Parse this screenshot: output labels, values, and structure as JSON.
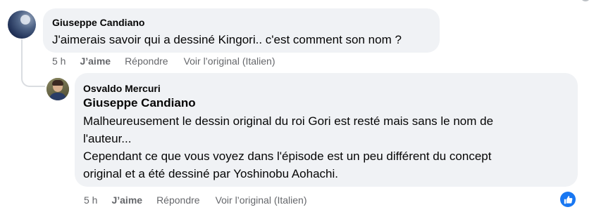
{
  "comments": [
    {
      "author": "Giuseppe Candiano",
      "text": "J'aimerais savoir qui a dessiné Kingori.. c'est comment son nom ?",
      "time": "5 h",
      "like_label": "J’aime",
      "reply_label": "Répondre",
      "original_label": "Voir l’original (Italien)"
    },
    {
      "author": "Osvaldo Mercuri",
      "mention": "Giuseppe Candiano",
      "lines": [
        "Malheureusement le dessin original du roi Gori est resté mais sans le nom de",
        "l'auteur...",
        "Cependant ce que vous voyez dans l'épisode est un peu différent du concept",
        "original et a été dessiné par Yoshinobu Aohachi."
      ],
      "time": "5 h",
      "like_label": "J’aime",
      "reply_label": "Répondre",
      "original_label": "Voir l’original (Italien)",
      "reaction": "like-icon"
    }
  ],
  "colors": {
    "bubble": "#f0f2f5",
    "meta_text": "#65676b",
    "accent": "#1877f2"
  }
}
